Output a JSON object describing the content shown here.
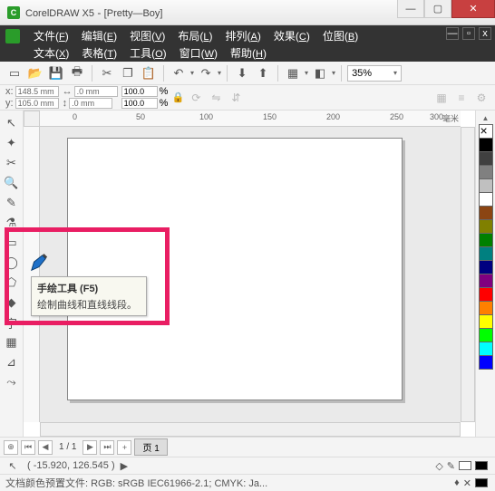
{
  "titlebar": {
    "app": "CorelDRAW X5",
    "doc": "[Pretty—Boy]"
  },
  "win_btns": {
    "min": "—",
    "max": "▢",
    "close": "✕"
  },
  "menu": {
    "row1": [
      {
        "label": "文件",
        "accel": "F"
      },
      {
        "label": "编辑",
        "accel": "E"
      },
      {
        "label": "视图",
        "accel": "V"
      },
      {
        "label": "布局",
        "accel": "L"
      },
      {
        "label": "排列",
        "accel": "A"
      },
      {
        "label": "效果",
        "accel": "C"
      },
      {
        "label": "位图",
        "accel": "B"
      }
    ],
    "row2": [
      {
        "label": "文本",
        "accel": "X"
      },
      {
        "label": "表格",
        "accel": "T"
      },
      {
        "label": "工具",
        "accel": "O"
      },
      {
        "label": "窗口",
        "accel": "W"
      },
      {
        "label": "帮助",
        "accel": "H"
      }
    ]
  },
  "mdi": {
    "min": "—",
    "max": "▫",
    "close": "x"
  },
  "toolbar": {
    "zoom": "35%"
  },
  "props": {
    "x_label": "x:",
    "x": "148.5 mm",
    "y_label": "y:",
    "y": "105.0 mm",
    "w": ".0 mm",
    "h": ".0 mm",
    "sx": "100.0",
    "sy": "100.0",
    "pct": "%"
  },
  "ruler": {
    "h_ticks": [
      {
        "pos": 36,
        "label": "0"
      },
      {
        "pos": 106,
        "label": "50"
      },
      {
        "pos": 176,
        "label": "100"
      },
      {
        "pos": 246,
        "label": "150"
      },
      {
        "pos": 316,
        "label": "200"
      },
      {
        "pos": 386,
        "label": "250"
      },
      {
        "pos": 430,
        "label": "300"
      }
    ],
    "unit": "毫米"
  },
  "palette": [
    "none",
    "#000000",
    "#404040",
    "#808080",
    "#c0c0c0",
    "#ffffff",
    "#8b4513",
    "#808000",
    "#008000",
    "#008080",
    "#000080",
    "#800080",
    "#ff0000",
    "#ff8000",
    "#ffff00",
    "#00ff00",
    "#00ffff",
    "#0000ff"
  ],
  "tooltip": {
    "title": "手绘工具 (F5)",
    "desc": "绘制曲线和直线线段。"
  },
  "nav": {
    "page_info": "1 / 1",
    "page_tab": "页 1",
    "first": "⏮",
    "prev": "◀",
    "next": "▶",
    "last": "⏭",
    "add": "+"
  },
  "status1": {
    "coords": "( -15.920, 126.545 )",
    "arrow": "▶"
  },
  "status2": {
    "profile": "文档颜色预置文件: RGB: sRGB IEC61966-2.1; CMYK: Ja...",
    "fill_none": "✕"
  }
}
